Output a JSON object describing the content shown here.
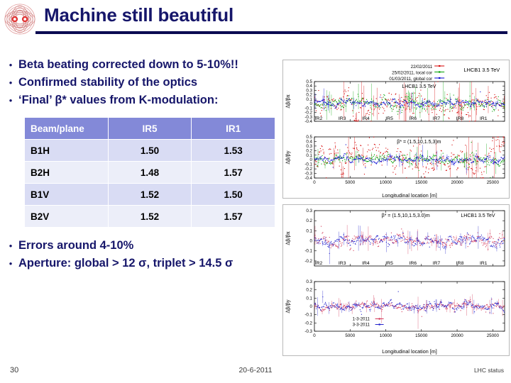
{
  "header": {
    "title": "Machine still beautiful",
    "logo_name": "cern-logo",
    "rule_color": "#0b0b52",
    "title_color": "#16166a"
  },
  "bullets_top": [
    {
      "marker": "•",
      "text": "Beta beating corrected down to 5-10%!!"
    },
    {
      "marker": "•",
      "text": "Confirmed stability of the optics"
    },
    {
      "marker": "•",
      "text": "‘Final’ β* values from K-modulation:"
    }
  ],
  "bullets_bottom": [
    {
      "marker": "•",
      "text": "Errors around 4-10%"
    },
    {
      "marker": "•",
      "text": "Aperture: global > 12 σ, triplet > 14.5 σ"
    }
  ],
  "table": {
    "headers": [
      "Beam/plane",
      "IR5",
      "IR1"
    ],
    "rows": [
      [
        "B1H",
        "1.50",
        "1.53"
      ],
      [
        "B2H",
        "1.48",
        "1.57"
      ],
      [
        "B1V",
        "1.52",
        "1.50"
      ],
      [
        "B2V",
        "1.52",
        "1.57"
      ]
    ],
    "header_bg": "#8389d8",
    "row_odd_bg": "#d9dcf4",
    "row_even_bg": "#eceef9"
  },
  "footer": {
    "slide_number": "30",
    "date": "20-6-2011",
    "right_label": "LHC status"
  },
  "chart_data": [
    {
      "id": "fig-top-x",
      "type": "scatter",
      "title": "",
      "ylabel": "Δβ/βx",
      "xlabel": "",
      "annotations": [
        "LHCB1 3.5 TeV"
      ],
      "legend": [
        {
          "label": "22/02/2011",
          "color": "#d40000"
        },
        {
          "label": "25/02/2011, local cor",
          "color": "#00a000"
        },
        {
          "label": "01/03/2011, global cor",
          "color": "#0000d0"
        }
      ],
      "legend_position": "top",
      "ylim": [
        -0.4,
        0.5
      ],
      "yticks": [
        0.5,
        0.4,
        0.3,
        0.2,
        0.1,
        0,
        -0.1,
        -0.2,
        -0.3,
        -0.4
      ],
      "xlim": [
        0,
        26659
      ],
      "xticks": [
        0,
        5000,
        10000,
        15000,
        20000,
        25000
      ],
      "xticklabels_shown": false,
      "ir_labels": [
        "IR2",
        "IR3",
        "IR4",
        "IR5",
        "IR6",
        "IR7",
        "IR8",
        "IR1"
      ],
      "ir_positions": [
        600,
        3900,
        7200,
        10500,
        13800,
        17100,
        20400,
        23700
      ],
      "series": [
        {
          "name": "22/02/2011",
          "color": "#d40000",
          "spread": 0.17,
          "n": 300
        },
        {
          "name": "25/02/2011, local cor",
          "color": "#00a000",
          "spread": 0.09,
          "n": 300
        },
        {
          "name": "01/03/2011, global cor",
          "color": "#0000d0",
          "spread": 0.05,
          "n": 300
        }
      ],
      "grid": false
    },
    {
      "id": "fig-top-y",
      "type": "scatter",
      "title": "",
      "ylabel": "Δβ/βy",
      "xlabel": "Longitudinal location [m]",
      "annotations": [
        "β* = (1.5,10,1.5,3)m"
      ],
      "legend": [],
      "ylim": [
        -0.4,
        0.5
      ],
      "yticks": [
        0.5,
        0.4,
        0.3,
        0.2,
        0.1,
        0,
        -0.1,
        -0.2,
        -0.3,
        -0.4
      ],
      "xlim": [
        0,
        26659
      ],
      "xticks": [
        0,
        5000,
        10000,
        15000,
        20000,
        25000
      ],
      "xticklabels_shown": true,
      "ir_labels": [],
      "series": [
        {
          "name": "22/02/2011",
          "color": "#d40000",
          "spread": 0.22,
          "n": 300
        },
        {
          "name": "25/02/2011, local cor",
          "color": "#00a000",
          "spread": 0.07,
          "n": 300
        },
        {
          "name": "01/03/2011, global cor",
          "color": "#0000d0",
          "spread": 0.045,
          "n": 300
        }
      ],
      "grid": false
    },
    {
      "id": "fig-bottom-x",
      "type": "scatter",
      "title": "",
      "ylabel": "Δβ/βx",
      "xlabel": "",
      "annotations": [
        "β* = (1.5,10,1.5,3.0)m",
        "LHCB1 3.5 TeV"
      ],
      "legend": [],
      "ylim": [
        -0.25,
        0.3
      ],
      "yticks": [
        0.3,
        0.2,
        0.1,
        0,
        -0.1,
        -0.2
      ],
      "xlim": [
        0,
        26659
      ],
      "xticks": [
        0,
        5000,
        10000,
        15000,
        20000,
        25000
      ],
      "xticklabels_shown": false,
      "ir_labels": [
        "IR2",
        "IR3",
        "IR4",
        "IR5",
        "IR6",
        "IR7",
        "IR8",
        "IR1"
      ],
      "ir_positions": [
        600,
        3900,
        7200,
        10500,
        13800,
        17100,
        20400,
        23700
      ],
      "series": [
        {
          "name": "1-3-2011",
          "color": "#d43a5a",
          "spread": 0.035,
          "n": 330
        },
        {
          "name": "3-3-2011",
          "color": "#2222cc",
          "spread": 0.035,
          "n": 330
        }
      ],
      "grid": false
    },
    {
      "id": "fig-bottom-y",
      "type": "scatter",
      "title": "",
      "ylabel": "Δβ/βy",
      "xlabel": "Longitudinal location [m]",
      "annotations": [],
      "legend": [
        {
          "label": "1-3-2011",
          "color": "#d43a5a"
        },
        {
          "label": "3-3-2011",
          "color": "#2222cc"
        }
      ],
      "legend_position": "inside-left",
      "ylim": [
        -0.3,
        0.3
      ],
      "yticks": [
        0.3,
        0.2,
        0.1,
        0,
        -0.1,
        -0.2,
        -0.3
      ],
      "xlim": [
        0,
        26659
      ],
      "xticks": [
        0,
        5000,
        10000,
        15000,
        20000,
        25000
      ],
      "xticklabels_shown": true,
      "ir_labels": [],
      "series": [
        {
          "name": "1-3-2011",
          "color": "#d43a5a",
          "spread": 0.03,
          "n": 330
        },
        {
          "name": "3-3-2011",
          "color": "#2222cc",
          "spread": 0.03,
          "n": 330
        }
      ],
      "grid": false
    }
  ]
}
